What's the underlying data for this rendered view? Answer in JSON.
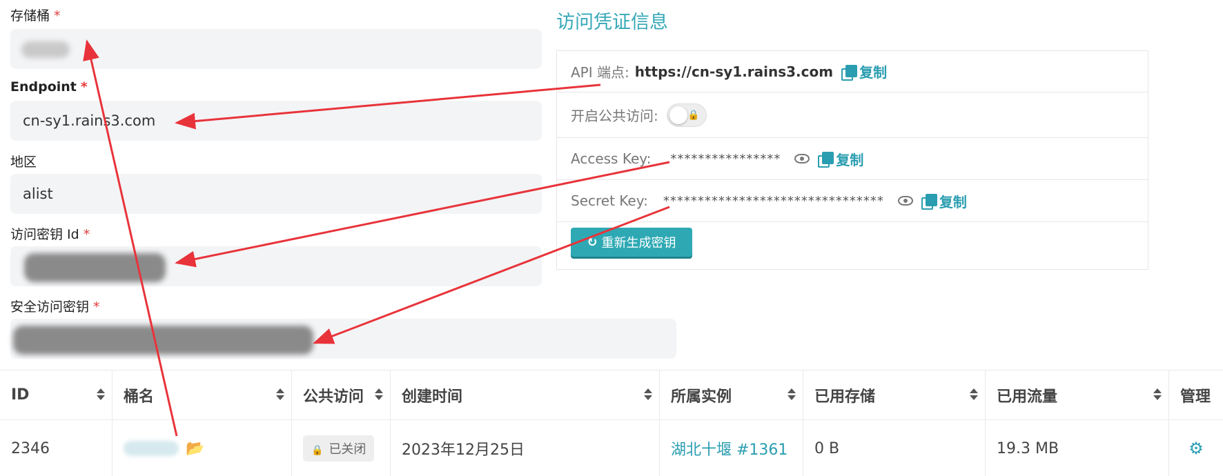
{
  "form": {
    "bucket_label": "存储桶",
    "endpoint_label": "Endpoint",
    "endpoint_value": "cn-sy1.rains3.com",
    "region_label": "地区",
    "region_value": "alist",
    "access_key_id_label": "访问密钥 Id",
    "secret_key_label": "安全访问密钥",
    "required_mark": "*"
  },
  "panel": {
    "title": "访问凭证信息",
    "api_endpoint_label": "API 端点:",
    "api_endpoint_value": "https://cn-sy1.rains3.com",
    "public_access_label": "开启公共访问:",
    "public_access_enabled": false,
    "access_key_label": "Access Key:",
    "access_key_masked": "****************",
    "secret_key_label": "Secret Key:",
    "secret_key_masked": "********************************",
    "copy_label": "复制",
    "regen_label": "重新生成密钥"
  },
  "table": {
    "headers": [
      "ID",
      "桶名",
      "公共访问",
      "创建时间",
      "所属实例",
      "已用存储",
      "已用流量",
      "管理"
    ],
    "row": {
      "id": "2346",
      "public_access": "已关闭",
      "created": "2023年12月25日",
      "instance": "湖北十堰 #1361",
      "used_storage": "0 B",
      "used_traffic": "19.3 MB"
    }
  },
  "colors": {
    "accent": "#2a9db0",
    "arrow": "#e8333a",
    "required": "#e23c3c"
  }
}
